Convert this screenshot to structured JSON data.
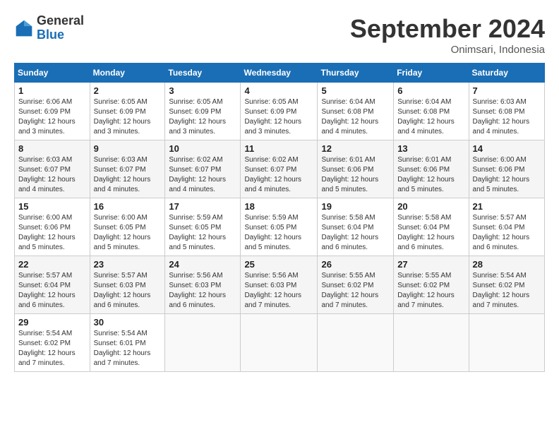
{
  "header": {
    "logo_general": "General",
    "logo_blue": "Blue",
    "month_title": "September 2024",
    "location": "Onimsari, Indonesia"
  },
  "days_of_week": [
    "Sunday",
    "Monday",
    "Tuesday",
    "Wednesday",
    "Thursday",
    "Friday",
    "Saturday"
  ],
  "weeks": [
    [
      {
        "day": "1",
        "sunrise": "6:06 AM",
        "sunset": "6:09 PM",
        "daylight": "12 hours and 3 minutes."
      },
      {
        "day": "2",
        "sunrise": "6:05 AM",
        "sunset": "6:09 PM",
        "daylight": "12 hours and 3 minutes."
      },
      {
        "day": "3",
        "sunrise": "6:05 AM",
        "sunset": "6:09 PM",
        "daylight": "12 hours and 3 minutes."
      },
      {
        "day": "4",
        "sunrise": "6:05 AM",
        "sunset": "6:09 PM",
        "daylight": "12 hours and 3 minutes."
      },
      {
        "day": "5",
        "sunrise": "6:04 AM",
        "sunset": "6:08 PM",
        "daylight": "12 hours and 4 minutes."
      },
      {
        "day": "6",
        "sunrise": "6:04 AM",
        "sunset": "6:08 PM",
        "daylight": "12 hours and 4 minutes."
      },
      {
        "day": "7",
        "sunrise": "6:03 AM",
        "sunset": "6:08 PM",
        "daylight": "12 hours and 4 minutes."
      }
    ],
    [
      {
        "day": "8",
        "sunrise": "6:03 AM",
        "sunset": "6:07 PM",
        "daylight": "12 hours and 4 minutes."
      },
      {
        "day": "9",
        "sunrise": "6:03 AM",
        "sunset": "6:07 PM",
        "daylight": "12 hours and 4 minutes."
      },
      {
        "day": "10",
        "sunrise": "6:02 AM",
        "sunset": "6:07 PM",
        "daylight": "12 hours and 4 minutes."
      },
      {
        "day": "11",
        "sunrise": "6:02 AM",
        "sunset": "6:07 PM",
        "daylight": "12 hours and 4 minutes."
      },
      {
        "day": "12",
        "sunrise": "6:01 AM",
        "sunset": "6:06 PM",
        "daylight": "12 hours and 5 minutes."
      },
      {
        "day": "13",
        "sunrise": "6:01 AM",
        "sunset": "6:06 PM",
        "daylight": "12 hours and 5 minutes."
      },
      {
        "day": "14",
        "sunrise": "6:00 AM",
        "sunset": "6:06 PM",
        "daylight": "12 hours and 5 minutes."
      }
    ],
    [
      {
        "day": "15",
        "sunrise": "6:00 AM",
        "sunset": "6:06 PM",
        "daylight": "12 hours and 5 minutes."
      },
      {
        "day": "16",
        "sunrise": "6:00 AM",
        "sunset": "6:05 PM",
        "daylight": "12 hours and 5 minutes."
      },
      {
        "day": "17",
        "sunrise": "5:59 AM",
        "sunset": "6:05 PM",
        "daylight": "12 hours and 5 minutes."
      },
      {
        "day": "18",
        "sunrise": "5:59 AM",
        "sunset": "6:05 PM",
        "daylight": "12 hours and 5 minutes."
      },
      {
        "day": "19",
        "sunrise": "5:58 AM",
        "sunset": "6:04 PM",
        "daylight": "12 hours and 6 minutes."
      },
      {
        "day": "20",
        "sunrise": "5:58 AM",
        "sunset": "6:04 PM",
        "daylight": "12 hours and 6 minutes."
      },
      {
        "day": "21",
        "sunrise": "5:57 AM",
        "sunset": "6:04 PM",
        "daylight": "12 hours and 6 minutes."
      }
    ],
    [
      {
        "day": "22",
        "sunrise": "5:57 AM",
        "sunset": "6:04 PM",
        "daylight": "12 hours and 6 minutes."
      },
      {
        "day": "23",
        "sunrise": "5:57 AM",
        "sunset": "6:03 PM",
        "daylight": "12 hours and 6 minutes."
      },
      {
        "day": "24",
        "sunrise": "5:56 AM",
        "sunset": "6:03 PM",
        "daylight": "12 hours and 6 minutes."
      },
      {
        "day": "25",
        "sunrise": "5:56 AM",
        "sunset": "6:03 PM",
        "daylight": "12 hours and 7 minutes."
      },
      {
        "day": "26",
        "sunrise": "5:55 AM",
        "sunset": "6:02 PM",
        "daylight": "12 hours and 7 minutes."
      },
      {
        "day": "27",
        "sunrise": "5:55 AM",
        "sunset": "6:02 PM",
        "daylight": "12 hours and 7 minutes."
      },
      {
        "day": "28",
        "sunrise": "5:54 AM",
        "sunset": "6:02 PM",
        "daylight": "12 hours and 7 minutes."
      }
    ],
    [
      {
        "day": "29",
        "sunrise": "5:54 AM",
        "sunset": "6:02 PM",
        "daylight": "12 hours and 7 minutes."
      },
      {
        "day": "30",
        "sunrise": "5:54 AM",
        "sunset": "6:01 PM",
        "daylight": "12 hours and 7 minutes."
      },
      null,
      null,
      null,
      null,
      null
    ]
  ]
}
